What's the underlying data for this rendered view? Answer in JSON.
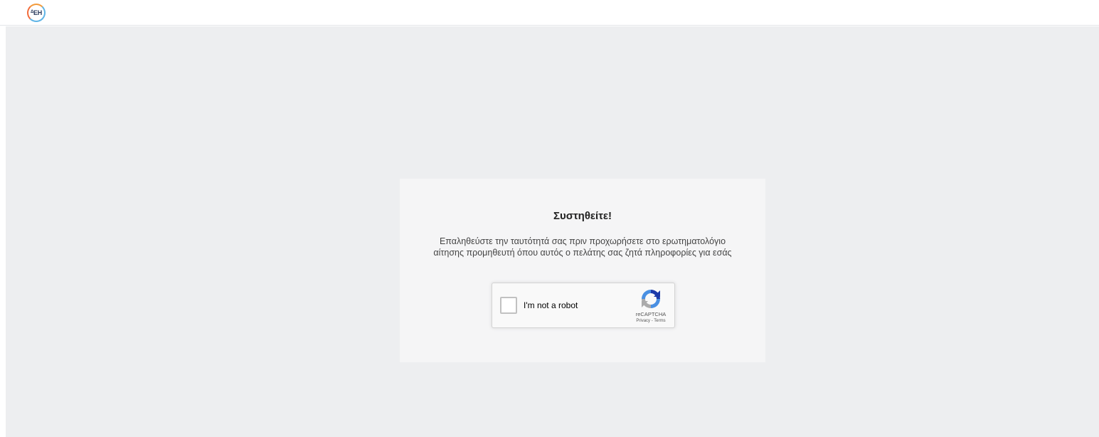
{
  "header": {
    "logo_text": "ΔΕΗ"
  },
  "card": {
    "title": "Συστηθείτε!",
    "description": "Επαληθεύστε την ταυτότητά σας πριν προχωρήσετε στο ερωτηματολόγιο αίτησης προμηθευτή όπου αυτός ο πελάτης σας ζητά πληροφορίες για εσάς"
  },
  "captcha": {
    "label": "I'm not a robot",
    "brand": "reCAPTCHA",
    "privacy_link": "Privacy",
    "separator": " - ",
    "terms_link": "Terms",
    "checked": false
  },
  "colors": {
    "page_bg": "#edeef0",
    "card_bg": "#f5f5f6",
    "recaptcha_blue": "#1c3aa9",
    "recaptcha_light_blue": "#4a90e2",
    "recaptcha_gray": "#ababab"
  }
}
